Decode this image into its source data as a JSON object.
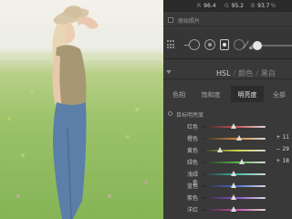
{
  "rgb_readout": {
    "r_label": "R",
    "r_value": "96.4",
    "g_label": "G",
    "g_value": "95.2",
    "b_label": "B",
    "b_value": "93.7",
    "unit": "%"
  },
  "original_photo": {
    "label": "原始照片",
    "checked": false
  },
  "hsl_panel": {
    "title": "HSL",
    "mode_color": "颜色",
    "mode_bw": "黑白",
    "tabs": [
      {
        "label": "色相",
        "active": false
      },
      {
        "label": "饱和度",
        "active": false
      },
      {
        "label": "明亮度",
        "active": true
      },
      {
        "label": "全部",
        "active": false
      }
    ],
    "section_label": "目标明亮度"
  },
  "sliders": [
    {
      "name": "红色",
      "value": "",
      "position": 0.5,
      "color": "#d05050"
    },
    {
      "name": "橙色",
      "value": "+ 11",
      "position": 0.58,
      "color": "#d88a3c"
    },
    {
      "name": "黄色",
      "value": "− 29",
      "position": 0.29,
      "color": "#cfcf4a"
    },
    {
      "name": "绿色",
      "value": "+ 18",
      "position": 0.63,
      "color": "#58b24a"
    },
    {
      "name": "浅绿色",
      "value": "",
      "position": 0.5,
      "color": "#46b7b0"
    },
    {
      "name": "蓝色",
      "value": "",
      "position": 0.5,
      "color": "#4a6fd0"
    },
    {
      "name": "紫色",
      "value": "",
      "position": 0.5,
      "color": "#8a52c8"
    },
    {
      "name": "洋红",
      "value": "",
      "position": 0.5,
      "color": "#c24fb2"
    }
  ],
  "toolbar_icons": [
    "grid-icon",
    "crop-overlay-icon",
    "spot-removal-icon",
    "red-eye-icon",
    "graduated-filter-icon",
    "adjustment-brush-icon"
  ]
}
